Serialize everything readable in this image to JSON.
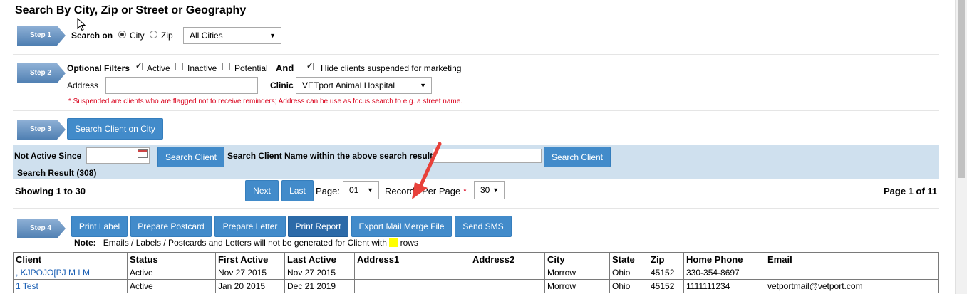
{
  "title": "Search By City, Zip or Street or Geography",
  "steps": {
    "step1": "Step 1",
    "step2": "Step 2",
    "step3": "Step 3",
    "step4": "Step 4"
  },
  "step1": {
    "search_on_label": "Search on",
    "radio_city": "City",
    "radio_zip": "Zip",
    "city_select_value": "All Cities"
  },
  "step2": {
    "optional_filters_label": "Optional Filters",
    "filter_active": "Active",
    "filter_inactive": "Inactive",
    "filter_potential": "Potential",
    "and_label": "And",
    "hide_suspended": "Hide clients suspended for marketing",
    "address_label": "Address",
    "clinic_label": "Clinic",
    "clinic_value": "VETport Animal Hospital",
    "note": "* Suspended are clients who are flagged not to receive reminders; Address can be use as focus search to e.g. a street name."
  },
  "step3": {
    "search_city_button": "Search Client on City"
  },
  "band": {
    "not_active_since_label": "Not Active Since",
    "search_client_button": "Search Client",
    "search_name_label": "Search Client Name within the above search result",
    "search_client_button2": "Search Client",
    "result_count": "Search Result (308)"
  },
  "paging": {
    "showing": "Showing 1 to 30",
    "next": "Next",
    "last": "Last",
    "page_label": "Page:",
    "page_value": "01",
    "records_label": "Records Per Page",
    "required_star": "*",
    "records_value": "30",
    "page_of": "Page 1 of 11"
  },
  "step4": {
    "buttons": [
      "Print Label",
      "Prepare Postcard",
      "Prepare Letter",
      "Print Report",
      "Export Mail Merge File",
      "Send SMS"
    ],
    "note_label": "Note:",
    "note_text": "Emails / Labels / Postcards and Letters will not be generated for Client with",
    "note_tail": "rows",
    "highlight_color": "#ffff00"
  },
  "table": {
    "columns": [
      "Client",
      "Status",
      "First Active",
      "Last Active",
      "Address1",
      "Address2",
      "City",
      "State",
      "Zip",
      "Home Phone",
      "Email"
    ],
    "rows": [
      [
        ", KJPOJO[PJ M LM",
        "Active",
        "Nov 27 2015",
        "Nov 27 2015",
        "",
        "",
        "Morrow",
        "Ohio",
        "45152",
        "330-354-8697",
        ""
      ],
      [
        "1 Test",
        "Active",
        "Jan 20 2015",
        "Dec 21 2019",
        "",
        "",
        "Morrow",
        "Ohio",
        "45152",
        "1111111234",
        "vetportmail@vetport.com"
      ]
    ]
  },
  "colors": {
    "button_blue": "#428bca",
    "button_active": "#2c6aa8",
    "band_bg": "#cfe0ee",
    "note_red": "#d9001b",
    "annotation_arrow": "#e8413a",
    "link_blue": "#1a5fb4"
  }
}
